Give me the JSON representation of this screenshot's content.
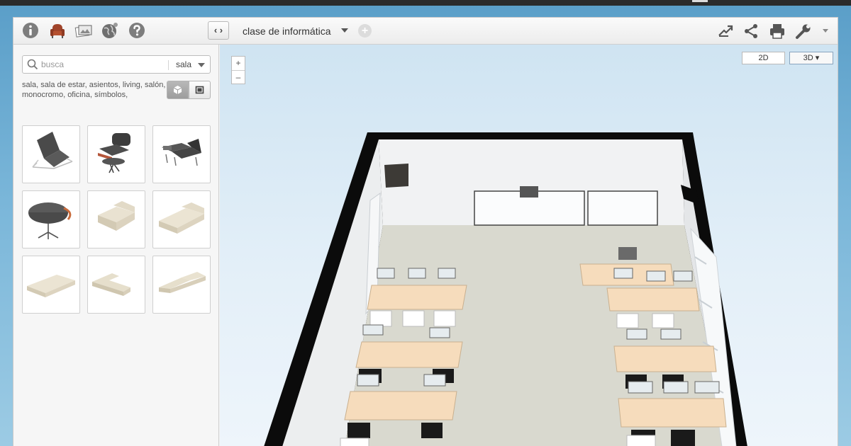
{
  "toolbar": {
    "left_icons": [
      "info-icon",
      "armchair-icon",
      "photos-icon",
      "globe-icon",
      "help-icon"
    ],
    "collapse_label": "‹ ›",
    "project_title": "clase de informática",
    "add_label": "+",
    "right_icons": [
      "export-icon",
      "share-icon",
      "print-icon",
      "wrench-icon"
    ]
  },
  "sidebar": {
    "search": {
      "value": "",
      "placeholder": "busca"
    },
    "category": "sala",
    "tags": "sala, sala de estar, asientos, living, salón, monocromo, oficina, símbolos,",
    "view_toggle": [
      "3d-cube-icon",
      "2d-square-icon"
    ],
    "catalog": [
      {
        "name": "lounge-chair-black"
      },
      {
        "name": "eames-chair-ottoman"
      },
      {
        "name": "daybed-black"
      },
      {
        "name": "ottoman-black"
      },
      {
        "name": "armchair-cream"
      },
      {
        "name": "sofa-two-seat-cream"
      },
      {
        "name": "sofa-three-seat-cream"
      },
      {
        "name": "sectional-sofa-cream"
      },
      {
        "name": "corner-sofa-cream"
      }
    ]
  },
  "viewport": {
    "zoom_in": "+",
    "zoom_out": "–",
    "mode_2d": "2D",
    "mode_3d": "3D ▾"
  },
  "colors": {
    "wall": "#0b0b0b",
    "floor": "#d9d9cf",
    "desk": "#f6dcbc",
    "sky": "#7ab6d9"
  }
}
